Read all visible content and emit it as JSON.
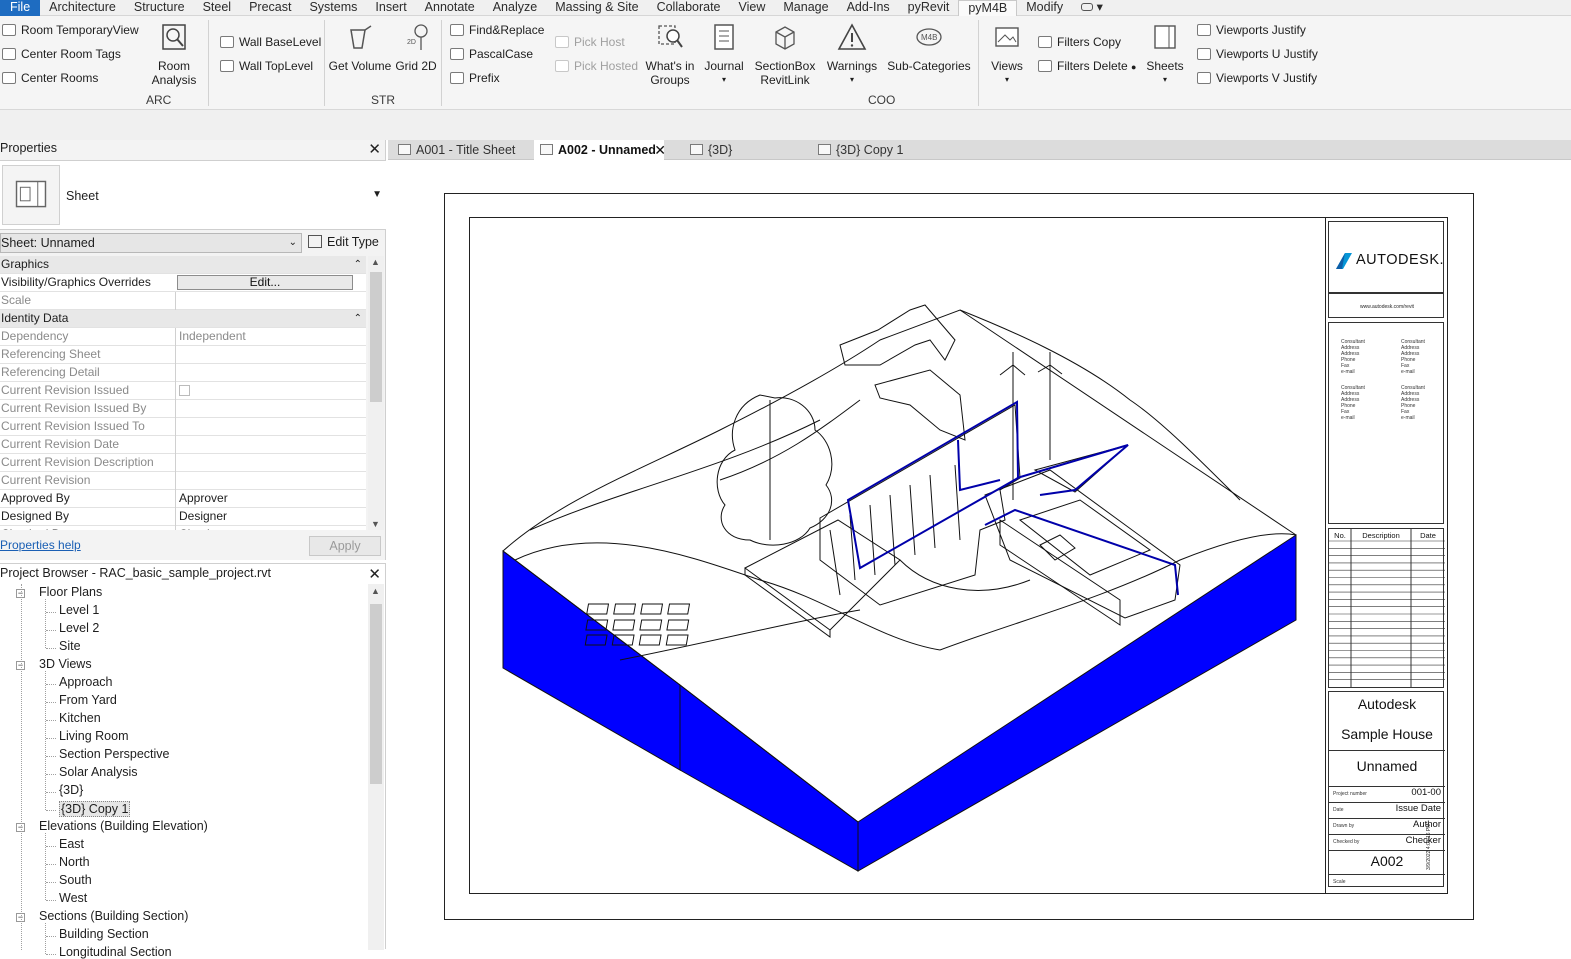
{
  "menu": {
    "tabs": [
      "File",
      "Architecture",
      "Structure",
      "Steel",
      "Precast",
      "Systems",
      "Insert",
      "Annotate",
      "Analyze",
      "Massing & Site",
      "Collaborate",
      "View",
      "Manage",
      "Add-Ins",
      "pyRevit",
      "pyM4B",
      "Modify"
    ],
    "active": "pyM4B"
  },
  "ribbon": {
    "arc": {
      "panel_label": "ARC",
      "room_temp_view": "Room TemporaryView",
      "center_room_tags": "Center Room Tags",
      "center_rooms": "Center Rooms",
      "room_analysis_1": "Room",
      "room_analysis_2": "Analysis",
      "wall_base_level": "Wall BaseLevel",
      "wall_top_level": "Wall TopLevel"
    },
    "str": {
      "panel_label": "STR",
      "get_volume": "Get Volume",
      "grid_2d": "Grid 2D"
    },
    "coo": {
      "panel_label": "COO",
      "find_replace": "Find&Replace",
      "pascal_case": "PascalCase",
      "prefix": "Prefix",
      "pick_host": "Pick Host",
      "pick_hosted": "Pick Hosted",
      "whats_in_groups_1": "What's in",
      "whats_in_groups_2": "Groups",
      "journal": "Journal",
      "section_box_1": "SectionBox",
      "section_box_2": "RevitLink",
      "warnings": "Warnings",
      "sub_categories": "Sub-Categories"
    },
    "views": {
      "views": "Views",
      "filters_copy": "Filters Copy",
      "filters_delete": "Filters Delete",
      "sheets": "Sheets",
      "viewports_justify": "Viewports Justify",
      "viewports_u_justify": "Viewports U Justify",
      "viewports_v_justify": "Viewports V Justify"
    }
  },
  "view_tabs": [
    {
      "label": "A001 - Title Sheet",
      "active": false
    },
    {
      "label": "A002 - Unnamed",
      "active": true
    },
    {
      "label": "{3D}",
      "active": false
    },
    {
      "label": "{3D} Copy 1",
      "active": false
    }
  ],
  "properties": {
    "title": "Properties",
    "type_name": "Sheet",
    "selector": "Sheet: Unnamed",
    "edit_type": "Edit Type",
    "rows": [
      {
        "k": "Graphics",
        "group": true
      },
      {
        "k": "Visibility/Graphics Overrides",
        "v": "Edit...",
        "button": true
      },
      {
        "k": "Scale",
        "v": "",
        "grey": true
      },
      {
        "k": "Identity Data",
        "group": true
      },
      {
        "k": "Dependency",
        "v": "Independent",
        "grey": true
      },
      {
        "k": "Referencing Sheet",
        "v": "",
        "grey": true
      },
      {
        "k": "Referencing Detail",
        "v": "",
        "grey": true
      },
      {
        "k": "Current Revision Issued",
        "v": "",
        "grey": true,
        "check": true
      },
      {
        "k": "Current Revision Issued By",
        "v": "",
        "grey": true
      },
      {
        "k": "Current Revision Issued To",
        "v": "",
        "grey": true
      },
      {
        "k": "Current Revision Date",
        "v": "",
        "grey": true
      },
      {
        "k": "Current Revision Description",
        "v": "",
        "grey": true
      },
      {
        "k": "Current Revision",
        "v": "",
        "grey": true
      },
      {
        "k": "Approved By",
        "v": "Approver"
      },
      {
        "k": "Designed By",
        "v": "Designer"
      },
      {
        "k": "Checked By",
        "v": "Checker"
      }
    ],
    "help": "Properties help",
    "apply": "Apply"
  },
  "browser": {
    "title": "Project Browser - RAC_basic_sample_project.rvt",
    "floor_plans": "Floor Plans",
    "floor_items": [
      "Level 1",
      "Level 2",
      "Site"
    ],
    "views_3d": "3D Views",
    "views_3d_items": [
      "Approach",
      "From Yard",
      "Kitchen",
      "Living Room",
      "Section Perspective",
      "Solar Analysis",
      "{3D}",
      "{3D} Copy 1"
    ],
    "elevations": "Elevations (Building Elevation)",
    "elevation_items": [
      "East",
      "North",
      "South",
      "West"
    ],
    "sections": "Sections (Building Section)",
    "section_items": [
      "Building Section",
      "Longitudinal Section"
    ]
  },
  "title_block": {
    "logo": "AUTODESK.",
    "url": "www.autodesk.com/revit",
    "consultant": [
      "Consultant",
      "Address",
      "Address",
      "Phone",
      "Fax",
      "e-mail"
    ],
    "rev_headers": [
      "No.",
      "Description",
      "Date"
    ],
    "company": "Autodesk",
    "project": "Sample House",
    "sheet_name": "Unnamed",
    "project_number_label": "Project number",
    "project_number": "001-00",
    "date_label": "Date",
    "date": "Issue Date",
    "drawn_label": "Drawn by",
    "drawn": "Author",
    "checked_label": "Checked by",
    "checked": "Checker",
    "sheet_number": "A002",
    "scale_label": "Scale",
    "side_stamp": "3/9/2022 4:03:16 PM"
  },
  "colors": {
    "accent": "#1e6cc1",
    "section_fill": "#0000ff",
    "linework": "#111111"
  }
}
